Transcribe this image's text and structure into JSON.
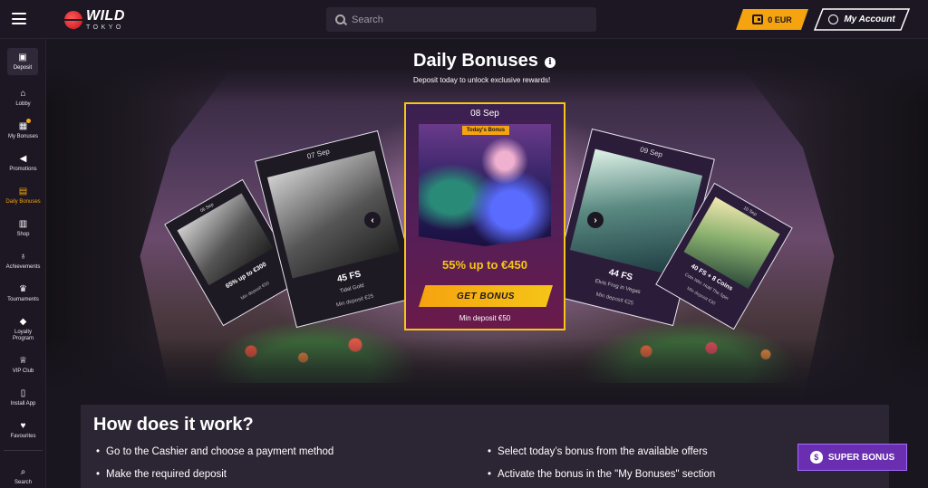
{
  "topbar": {
    "logo_main": "WILD",
    "logo_sub": "TOKYO",
    "search_placeholder": "Search",
    "balance": "0 EUR",
    "account_label": "My Account"
  },
  "sidebar": {
    "items": [
      {
        "label": "Deposit"
      },
      {
        "label": "Lobby"
      },
      {
        "label": "My Bonuses"
      },
      {
        "label": "Promotions"
      },
      {
        "label": "Daily Bonuses"
      },
      {
        "label": "Shop"
      },
      {
        "label": "Achievements"
      },
      {
        "label": "Tournaments"
      },
      {
        "label": "Loyalty Program"
      },
      {
        "label": "VIP Club"
      },
      {
        "label": "Install App"
      },
      {
        "label": "Favourites"
      },
      {
        "label": "Search"
      }
    ]
  },
  "hero": {
    "title": "Daily Bonuses",
    "subtitle": "Deposit today to unlock exclusive rewards!",
    "cards": {
      "far_left": {
        "date": "06 Sep",
        "offer": "65% up to €300",
        "min": "Min deposit €50"
      },
      "left": {
        "date": "07 Sep",
        "fs": "45 FS",
        "game": "Tidal Gold",
        "min": "Min deposit €25"
      },
      "center": {
        "date": "08 Sep",
        "badge": "Today's Bonus",
        "offer": "55% up to €450",
        "cta": "GET BONUS",
        "min": "Min deposit €50"
      },
      "right": {
        "date": "09 Sep",
        "fs": "44 FS",
        "game": "Elvis Frog in Vegas",
        "min": "Min deposit €25"
      },
      "far_right": {
        "date": "10 Sep",
        "fs": "40 FS + 8 Coins",
        "game": "Coin Win: Hold The Spin",
        "min": "Min deposit €30"
      }
    }
  },
  "how": {
    "title": "How does it work?",
    "steps": [
      "Go to the Cashier and choose a payment method",
      "Make the required deposit",
      "Select today’s bonus from the available offers",
      "Activate the bonus in the \"My Bonuses\" section"
    ]
  },
  "super_bonus": {
    "label": "SUPER BONUS"
  },
  "colors": {
    "accent": "#f5a30f",
    "highlight": "#f5c518",
    "purple": "#6a2fb0"
  }
}
